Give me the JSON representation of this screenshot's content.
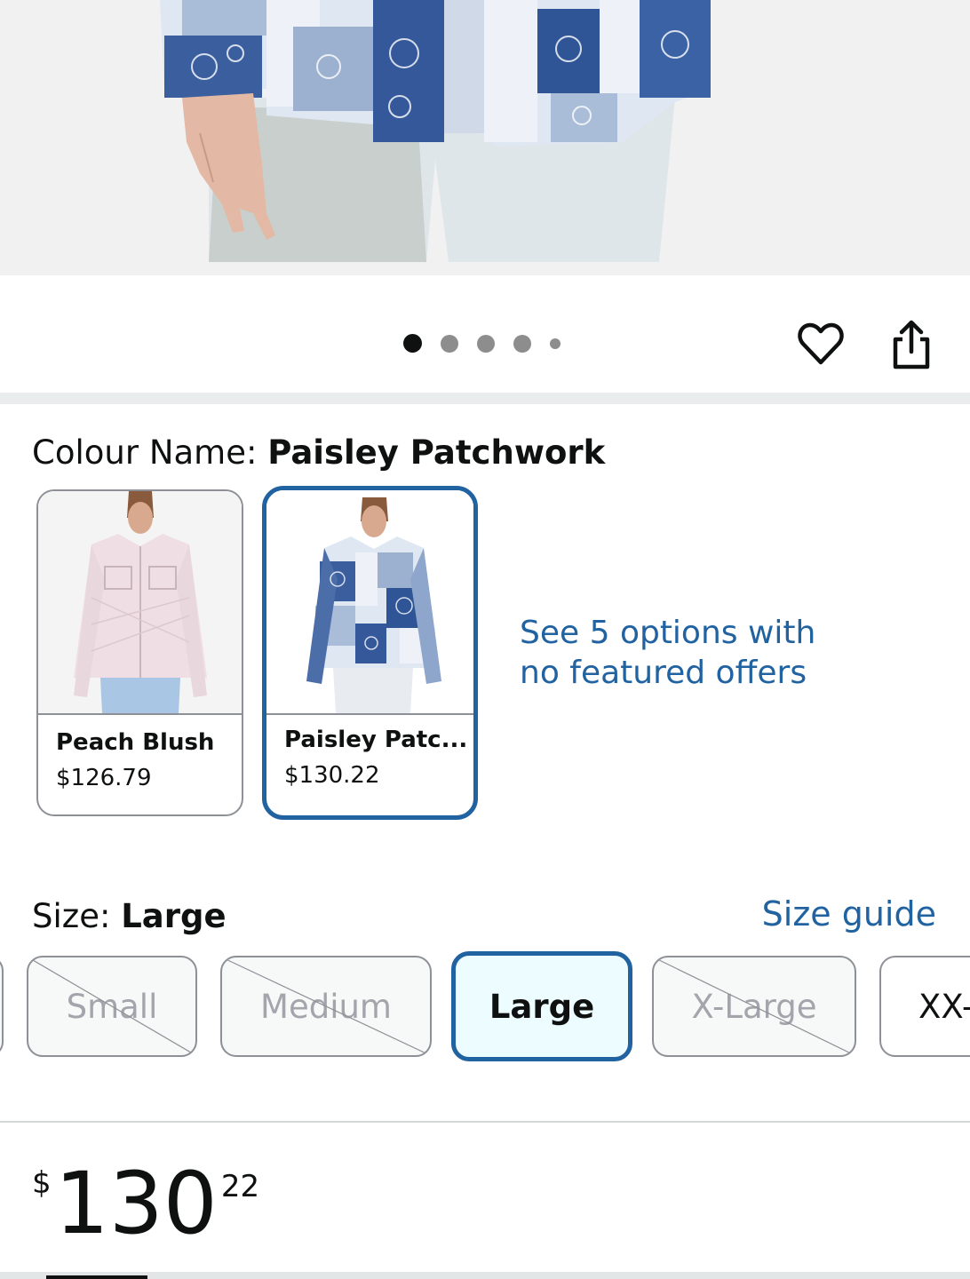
{
  "hero": {
    "image": "product-photo-paisley-jacket-closeup"
  },
  "pager": {
    "count": 5,
    "active": 0
  },
  "actions": {
    "wishlist_icon": "heart-icon",
    "share_icon": "share-icon"
  },
  "colour": {
    "label": "Colour Name: ",
    "value": "Paisley Patchwork",
    "options": [
      {
        "name": "Peach Blush",
        "price": "$126.79",
        "selected": false
      },
      {
        "name": "Paisley Patc...",
        "price": "$130.22",
        "selected": true
      }
    ],
    "see_options": "See 5 options with no featured offers"
  },
  "size": {
    "label": "Size: ",
    "value": "Large",
    "guide": "Size guide",
    "options": [
      {
        "label": "Small",
        "available": false
      },
      {
        "label": "Medium",
        "available": false
      },
      {
        "label": "Large",
        "available": true,
        "selected": true
      },
      {
        "label": "X-Large",
        "available": false
      },
      {
        "label": "XX-",
        "available": true
      }
    ]
  },
  "price": {
    "symbol": "$",
    "whole": "130",
    "fraction": "22"
  },
  "colors": {
    "link": "#2162a1",
    "selected_border": "#2162a1",
    "text": "#0f1111"
  }
}
